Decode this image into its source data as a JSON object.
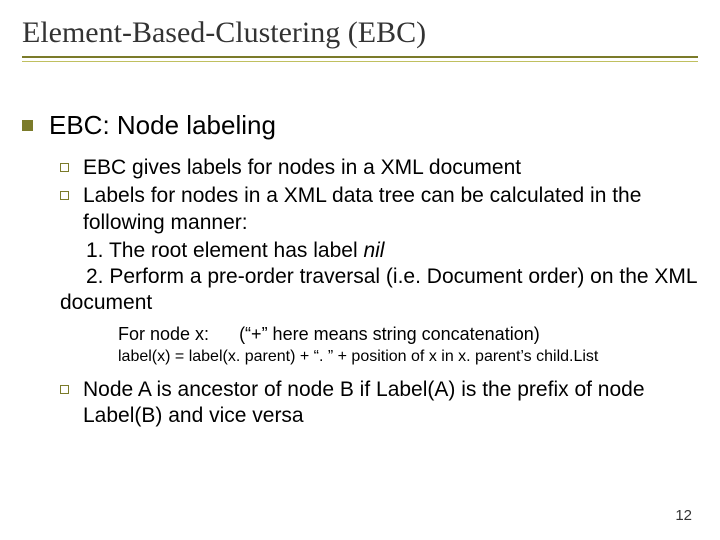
{
  "title": "Element-Based-Clustering (EBC)",
  "heading": "EBC: Node labeling",
  "sub1": "EBC gives labels for nodes in a XML document",
  "sub2": "Labels for nodes in a XML data tree can be calculated in the following manner:",
  "step1_pre": "1. The root element has label ",
  "step1_nil": "nil",
  "step2": "2. Perform a pre-order traversal (i.e. Document order) on the XML document",
  "note_prefix": "For node x:",
  "note_rest": "(“+” here means string concatenation)",
  "formula": "label(x) = label(x. parent) + “. ” + position of x in x. parent’s child.List",
  "sub3": "Node A is ancestor of node B if Label(A) is the prefix of node Label(B) and vice versa",
  "page_number": "12"
}
